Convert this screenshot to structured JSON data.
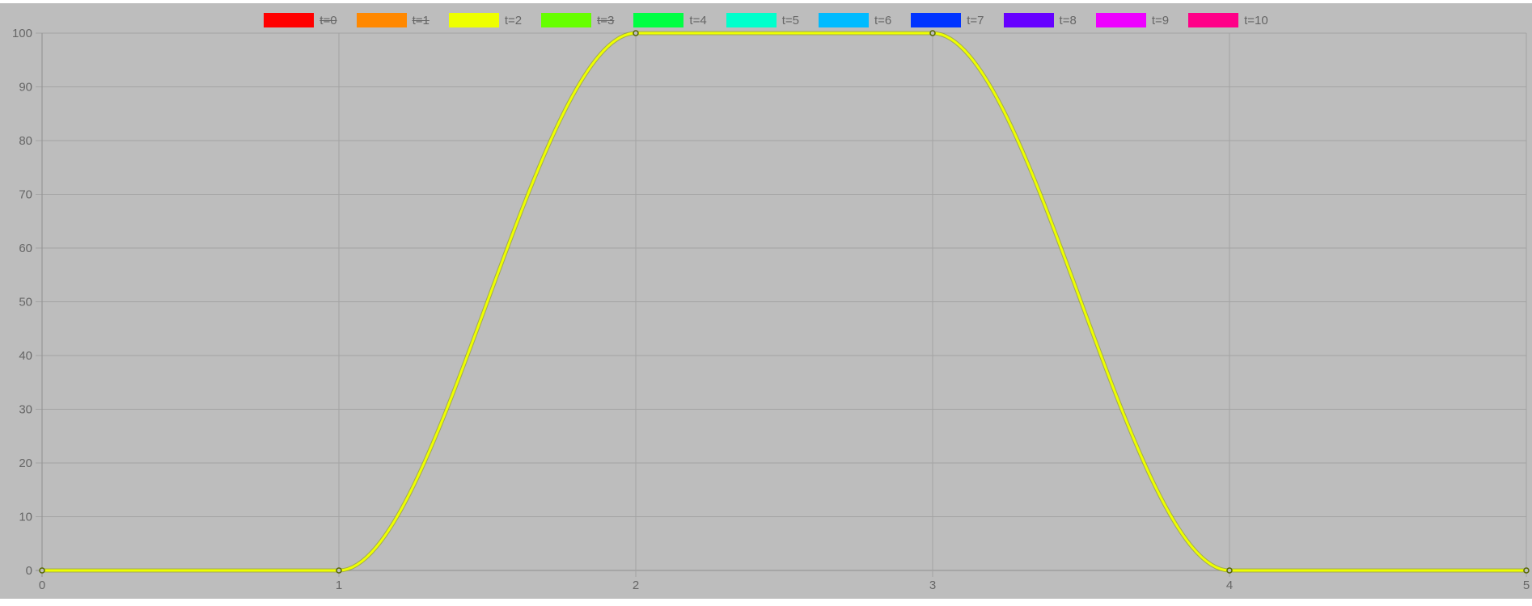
{
  "legend": {
    "items": [
      {
        "label": "t=0",
        "color": "#ff0000",
        "hidden": true
      },
      {
        "label": "t=1",
        "color": "#ff8800",
        "hidden": true
      },
      {
        "label": "t=2",
        "color": "#eeff00",
        "hidden": false
      },
      {
        "label": "t=3",
        "color": "#66ff00",
        "hidden": true
      },
      {
        "label": "t=4",
        "color": "#00ff44",
        "hidden": false
      },
      {
        "label": "t=5",
        "color": "#00ffcc",
        "hidden": false
      },
      {
        "label": "t=6",
        "color": "#00bbff",
        "hidden": false
      },
      {
        "label": "t=7",
        "color": "#0033ff",
        "hidden": false
      },
      {
        "label": "t=8",
        "color": "#6600ff",
        "hidden": false
      },
      {
        "label": "t=9",
        "color": "#ee00ff",
        "hidden": false
      },
      {
        "label": "t=10",
        "color": "#ff0088",
        "hidden": false
      }
    ]
  },
  "chart_data": {
    "type": "line",
    "title": "",
    "xlabel": "",
    "ylabel": "",
    "xlim": [
      0,
      5
    ],
    "ylim": [
      0,
      100
    ],
    "xticks": [
      "0",
      "1",
      "2",
      "3",
      "4",
      "5"
    ],
    "yticks": [
      "0",
      "10",
      "20",
      "30",
      "40",
      "50",
      "60",
      "70",
      "80",
      "90",
      "100"
    ],
    "grid": true,
    "background": "#bdbdbd",
    "legend_position": "top",
    "series": [
      {
        "name": "t=2",
        "color": "#eeff00",
        "smooth": true,
        "x": [
          0,
          1,
          2,
          3,
          4,
          5
        ],
        "y": [
          0,
          0,
          100,
          100,
          0,
          0
        ]
      }
    ]
  }
}
